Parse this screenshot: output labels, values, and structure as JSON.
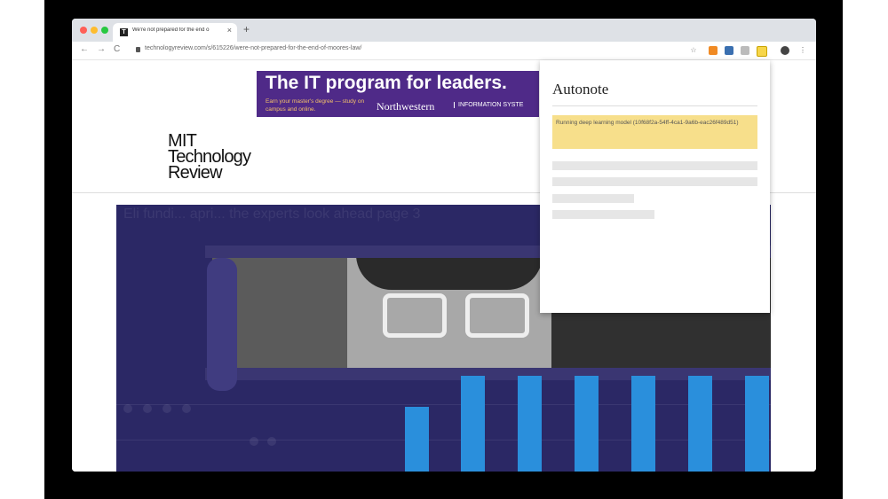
{
  "browser": {
    "tab_title": "We're not prepared for the end o",
    "tab_favicon": "T",
    "tab_close": "×",
    "new_tab": "+",
    "url": "technologyreview.com/s/615226/were-not-prepared-for-the-end-of-moores-law/",
    "nav": {
      "back": "←",
      "forward": "→",
      "reload": "C"
    }
  },
  "ad": {
    "headline": "The IT program for leaders.",
    "subline": "Earn your master's degree — study on campus and online.",
    "brand": "Northwestern",
    "unit": "INFORMATION SYSTE"
  },
  "site": {
    "logo_line1": "MIT",
    "logo_line2": "Technology",
    "logo_line3": "Review"
  },
  "hero": {
    "faded_text": "Eli fundi... apri... the experts look ahead page 3"
  },
  "popup": {
    "title": "Autonote",
    "status": "Running deep learning model (10f68f2a-54ff-4ca1-9a6b-eac26f489d51)"
  },
  "colors": {
    "ad_bg": "#4f2a88",
    "hero_bg": "#2b2865",
    "bar": "#2a8fdc",
    "status_bg": "#f7df8b"
  }
}
